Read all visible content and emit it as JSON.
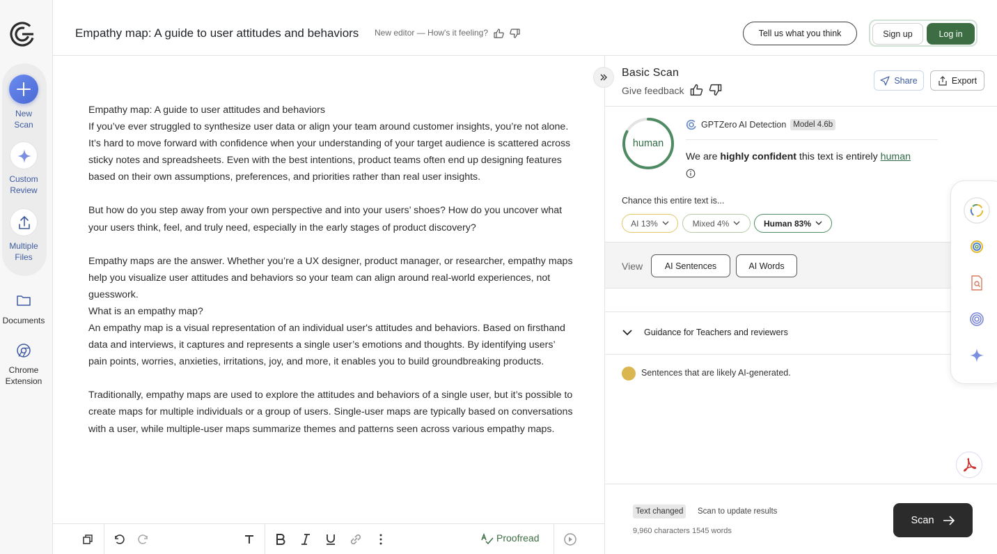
{
  "sidebar": {
    "new_scan": "New\nScan",
    "new_scan_l1": "New",
    "new_scan_l2": "Scan",
    "custom_l1": "Custom",
    "custom_l2": "Review",
    "multiple_l1": "Multiple",
    "multiple_l2": "Files",
    "documents": "Documents",
    "chrome_l1": "Chrome",
    "chrome_l2": "Extension"
  },
  "header": {
    "doc_title": "Empathy map: A guide to user attitudes and behaviors",
    "editor_note": "New editor — How's it feeling?",
    "feedback_button": "Tell us what you think",
    "signup": "Sign up",
    "login": "Log in"
  },
  "document": {
    "paragraphs": [
      "Empathy map: A guide to user attitudes and behaviors",
      "If you’ve ever struggled to synthesize user data or align your team around customer insights, you’re not alone. It’s hard to move forward with confidence when your understanding of your target audience is scattered across sticky notes and spreadsheets. Even with the best intentions, product teams often end up designing features based on their own assumptions, preferences, and priorities rather than real user insights.",
      "But how do you step away from your own perspective and into your users’ shoes? How do you uncover what your users think, feel, and truly need, especially in the early stages of product discovery?",
      "Empathy maps are the answer. Whether you’re a UX designer, product manager, or researcher, empathy maps help you visualize user attitudes and behaviors so your team can align around real-world experiences, not guesswork.",
      "What is an empathy map?",
      "An empathy map is a visual representation of an individual user's attitudes and behaviors. Based on firsthand data and interviews, it captures and represents a single user’s emotions and thoughts. By identifying users’ pain points, worries, anxieties, irritations, joy, and more, it enables you to build groundbreaking products.",
      "Traditionally, empathy maps are used to explore the attitudes and behaviors of a single user, but it’s possible to create maps for multiple individuals or a group of users. Single-user maps are typically based on conversations with a user, while multiple-user maps summarize themes and patterns seen across various empathy maps."
    ]
  },
  "toolbar": {
    "proofread": "Proofread"
  },
  "panel": {
    "title": "Basic Scan",
    "give_feedback": "Give feedback",
    "share": "Share",
    "export": "Export",
    "gauge_label": "human",
    "human_fraction": 0.83,
    "detector_name": "GPTZero AI Detection",
    "model": "Model 4.6b",
    "verdict_pre": "We are ",
    "verdict_bold": "highly confident",
    "verdict_mid": " this text is entirely ",
    "verdict_highlight": "human",
    "chance_label": "Chance this entire text is...",
    "chips": {
      "ai": "AI 13%",
      "mixed": "Mixed 4%",
      "human": "Human 83%"
    },
    "view_label": "View",
    "view_sentences": "AI Sentences",
    "view_words": "AI Words",
    "guidance": "Guidance for Teachers and reviewers",
    "legend": "Sentences that are likely AI-generated.",
    "text_changed": "Text changed",
    "scan_msg": "Scan to update results",
    "counts": "9,960 characters 1545 words",
    "scan_button": "Scan"
  },
  "colors": {
    "brand_green": "#3d6e43",
    "human_green": "#2f6b45",
    "ai_yellow": "#d9b650",
    "accent_blue": "#3d5aa0"
  }
}
